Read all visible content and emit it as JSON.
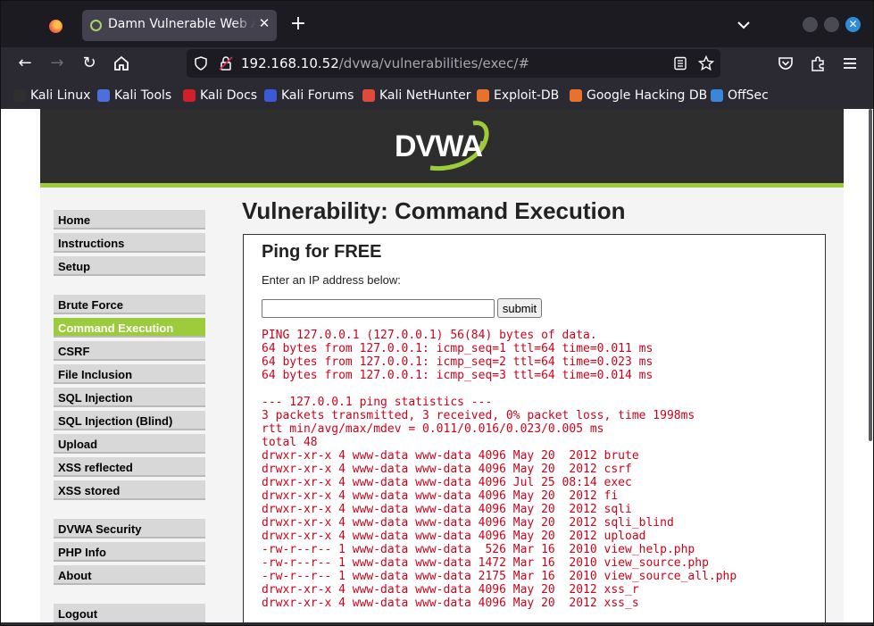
{
  "browser": {
    "tab": {
      "title": "Damn Vulnerable Web App (DVWA)"
    },
    "url": {
      "host": "192.168.10.52",
      "path": "/dvwa/vulnerabilities/exec/#"
    },
    "bookmarks": [
      {
        "label": "Kali Linux",
        "icon": "kali-dragon-icon"
      },
      {
        "label": "Kali Tools",
        "icon": "kali-tools-icon"
      },
      {
        "label": "Kali Docs",
        "icon": "kali-docs-icon"
      },
      {
        "label": "Kali Forums",
        "icon": "kali-forums-icon"
      },
      {
        "label": "Kali NetHunter",
        "icon": "nethunter-icon"
      },
      {
        "label": "Exploit-DB",
        "icon": "exploit-db-icon"
      },
      {
        "label": "Google Hacking DB",
        "icon": "ghdb-icon"
      },
      {
        "label": "OffSec",
        "icon": "offsec-icon"
      }
    ]
  },
  "dvwa": {
    "logo_text": "DVWA",
    "menu": [
      {
        "label": "Home"
      },
      {
        "label": "Instructions"
      },
      {
        "label": "Setup"
      },
      {
        "label": "Brute Force"
      },
      {
        "label": "Command Execution",
        "selected": true
      },
      {
        "label": "CSRF"
      },
      {
        "label": "File Inclusion"
      },
      {
        "label": "SQL Injection"
      },
      {
        "label": "SQL Injection (Blind)"
      },
      {
        "label": "Upload"
      },
      {
        "label": "XSS reflected"
      },
      {
        "label": "XSS stored"
      },
      {
        "label": "DVWA Security"
      },
      {
        "label": "PHP Info"
      },
      {
        "label": "About"
      },
      {
        "label": "Logout"
      }
    ],
    "page_title": "Vulnerability: Command Execution",
    "box_heading": "Ping for FREE",
    "ip_label": "Enter an IP address below:",
    "ip_value": "",
    "submit_label": "submit",
    "output_lines": [
      "PING 127.0.0.1 (127.0.0.1) 56(84) bytes of data.",
      "64 bytes from 127.0.0.1: icmp_seq=1 ttl=64 time=0.011 ms",
      "64 bytes from 127.0.0.1: icmp_seq=2 ttl=64 time=0.023 ms",
      "64 bytes from 127.0.0.1: icmp_seq=3 ttl=64 time=0.014 ms",
      "",
      "--- 127.0.0.1 ping statistics ---",
      "3 packets transmitted, 3 received, 0% packet loss, time 1998ms",
      "rtt min/avg/max/mdev = 0.011/0.016/0.023/0.005 ms",
      "total 48",
      "drwxr-xr-x 4 www-data www-data 4096 May 20  2012 brute",
      "drwxr-xr-x 4 www-data www-data 4096 May 20  2012 csrf",
      "drwxr-xr-x 4 www-data www-data 4096 Jul 25 08:14 exec",
      "drwxr-xr-x 4 www-data www-data 4096 May 20  2012 fi",
      "drwxr-xr-x 4 www-data www-data 4096 May 20  2012 sqli",
      "drwxr-xr-x 4 www-data www-data 4096 May 20  2012 sqli_blind",
      "drwxr-xr-x 4 www-data www-data 4096 May 20  2012 upload",
      "-rw-r--r-- 1 www-data www-data  526 Mar 16  2010 view_help.php",
      "-rw-r--r-- 1 www-data www-data 1472 Mar 16  2010 view_source.php",
      "-rw-r--r-- 1 www-data www-data 2175 Mar 16  2010 view_source_all.php",
      "drwxr-xr-x 4 www-data www-data 4096 May 20  2012 xss_r",
      "drwxr-xr-x 4 www-data www-data 4096 May 20  2012 xss_s"
    ]
  },
  "colors": {
    "accent_green": "#9ccc3c",
    "output_red": "#d0021b",
    "header_dark": "#2e2e2e"
  }
}
